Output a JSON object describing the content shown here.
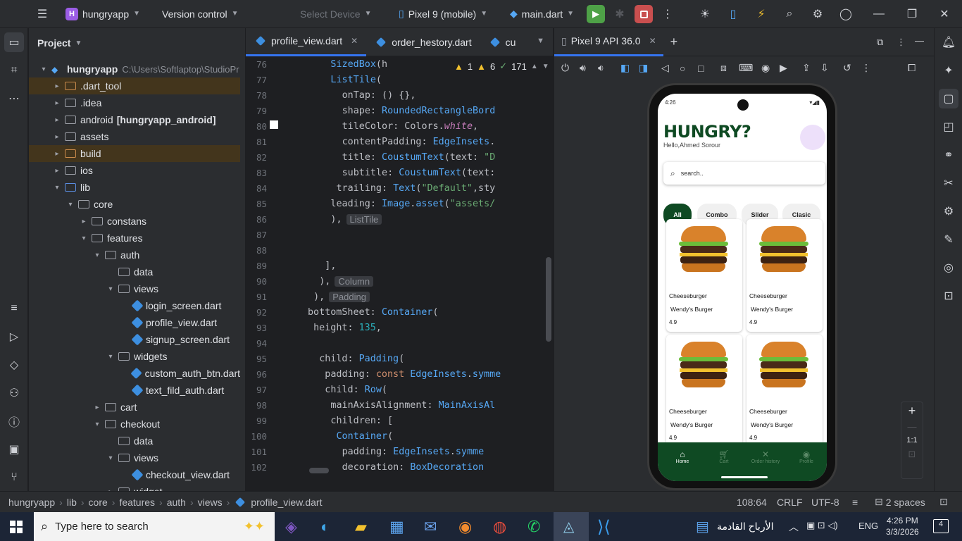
{
  "topbar": {
    "project_badge": "H",
    "project_name": "hungryapp",
    "vcs": "Version control",
    "select_device": "Select Device",
    "device": "Pixel 9 (mobile)",
    "run_config": "main.dart"
  },
  "project_panel": {
    "title": "Project",
    "root": "hungryapp",
    "root_path": "C:\\Users\\Softlaptop\\StudioPr",
    "items": [
      {
        "label": ".dart_tool",
        "extra": ""
      },
      {
        "label": ".idea",
        "extra": ""
      },
      {
        "label": "android",
        "extra": "[hungryapp_android]"
      },
      {
        "label": "assets",
        "extra": ""
      },
      {
        "label": "build",
        "extra": ""
      },
      {
        "label": "ios",
        "extra": ""
      },
      {
        "label": "lib",
        "extra": ""
      },
      {
        "label": "core",
        "extra": ""
      },
      {
        "label": "constans",
        "extra": ""
      },
      {
        "label": "features",
        "extra": ""
      },
      {
        "label": "auth",
        "extra": ""
      },
      {
        "label": "data",
        "extra": ""
      },
      {
        "label": "views",
        "extra": ""
      },
      {
        "label": "login_screen.dart",
        "extra": ""
      },
      {
        "label": "profile_view.dart",
        "extra": ""
      },
      {
        "label": "signup_screen.dart",
        "extra": ""
      },
      {
        "label": "widgets",
        "extra": ""
      },
      {
        "label": "custom_auth_btn.dart",
        "extra": ""
      },
      {
        "label": "text_fild_auth.dart",
        "extra": ""
      },
      {
        "label": "cart",
        "extra": ""
      },
      {
        "label": "checkout",
        "extra": ""
      },
      {
        "label": "data",
        "extra": ""
      },
      {
        "label": "views",
        "extra": ""
      },
      {
        "label": "checkout_view.dart",
        "extra": ""
      },
      {
        "label": "widget",
        "extra": ""
      }
    ]
  },
  "editor": {
    "tabs": [
      "profile_view.dart",
      "order_hestory.dart",
      "cu"
    ],
    "inspections": {
      "warn1": "1",
      "warn2": "6",
      "ok": "171"
    },
    "lines": [
      {
        "n": "76",
        "code": "SizedBox(h"
      },
      {
        "n": "77",
        "code": "ListTile("
      },
      {
        "n": "78",
        "code": "onTap: () {},"
      },
      {
        "n": "79",
        "code": "shape: RoundedRectangleBord"
      },
      {
        "n": "80",
        "code": "tileColor: Colors.white,"
      },
      {
        "n": "81",
        "code": "contentPadding: EdgeInsets."
      },
      {
        "n": "82",
        "code": "title: CoustumText(text: \"D"
      },
      {
        "n": "83",
        "code": "subtitle: CoustumText(text:"
      },
      {
        "n": "84",
        "code": "trailing: Text(\"Default\",sty"
      },
      {
        "n": "85",
        "code": "leading: Image.asset(\"assets/"
      },
      {
        "n": "86",
        "code": "),"
      },
      {
        "n": "87",
        "code": ""
      },
      {
        "n": "88",
        "code": ""
      },
      {
        "n": "89",
        "code": "],"
      },
      {
        "n": "90",
        "code": "),"
      },
      {
        "n": "91",
        "code": "),"
      },
      {
        "n": "92",
        "code": "bottomSheet: Container("
      },
      {
        "n": "93",
        "code": "height: 135,"
      },
      {
        "n": "94",
        "code": ""
      },
      {
        "n": "95",
        "code": "child: Padding("
      },
      {
        "n": "96",
        "code": "padding: const EdgeInsets.symme"
      },
      {
        "n": "97",
        "code": "child: Row("
      },
      {
        "n": "98",
        "code": "mainAxisAlignment: MainAxisAl"
      },
      {
        "n": "99",
        "code": "children: ["
      },
      {
        "n": "100",
        "code": "Container("
      },
      {
        "n": "101",
        "code": "padding: EdgeInsets.symme"
      },
      {
        "n": "102",
        "code": "decoration: BoxDecoration"
      }
    ],
    "hints": {
      "h86": "ListTile",
      "h90": "Column",
      "h91": "Padding"
    }
  },
  "emulator": {
    "tab": "Pixel 9 API 36.0",
    "zoom": "1:1"
  },
  "app": {
    "status_time": "4:26",
    "title": "HUNGRY?",
    "greeting": "Hello,Ahmed Sorour",
    "search_placeholder": "search..",
    "chips": [
      "All",
      "Combo",
      "Slider",
      "Clasic"
    ],
    "cards": [
      {
        "name": "Cheeseburger",
        "brand": "Wendy's Burger",
        "rating": "4.9"
      },
      {
        "name": "Cheeseburger",
        "brand": "Wendy's Burger",
        "rating": "4.9"
      },
      {
        "name": "Cheeseburger",
        "brand": "Wendy's Burger",
        "rating": "4.9"
      },
      {
        "name": "Cheeseburger",
        "brand": "Wendy's Burger",
        "rating": "4.9"
      }
    ],
    "nav": [
      "Home",
      "Cart",
      "Order history",
      "Profile"
    ],
    "brand_color": "#0f4a23"
  },
  "statusbar": {
    "breadcrumb": [
      "hungryapp",
      "lib",
      "core",
      "features",
      "auth",
      "views",
      "profile_view.dart"
    ],
    "position": "108:64",
    "line_sep": "CRLF",
    "encoding": "UTF-8",
    "indent": "2 spaces"
  },
  "taskbar": {
    "search": "Type here to search",
    "news": "الأرباح القادمة",
    "lang": "ENG",
    "time": "4:26 PM",
    "date": "3/3/2026",
    "notifications": "4"
  }
}
